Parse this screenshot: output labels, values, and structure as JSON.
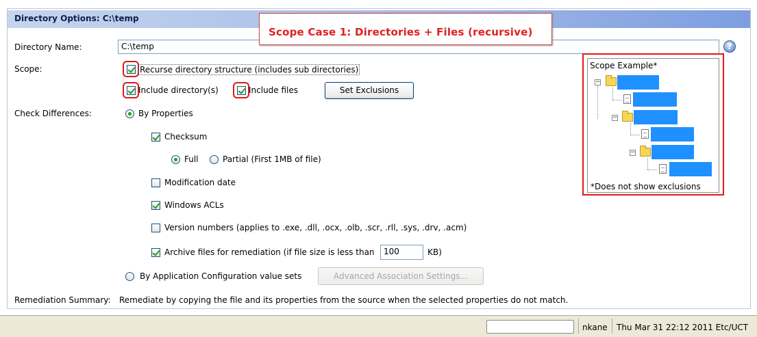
{
  "header": {
    "title": "Directory Options: C:\\temp"
  },
  "callout": {
    "text": "Scope Case 1: Directories + Files (recursive)"
  },
  "directory": {
    "label": "Directory Name:",
    "value": "C:\\temp"
  },
  "scope": {
    "label": "Scope:",
    "recurse_label": "Recurse directory structure (includes sub directories)",
    "include_dirs_label": "Include directory(s)",
    "include_files_label": "Include files",
    "set_exclusions_label": "Set Exclusions"
  },
  "check": {
    "label": "Check Differences:",
    "by_properties": "By Properties",
    "checksum": "Checksum",
    "full": "Full",
    "partial": "Partial (First 1MB of file)",
    "mod_date": "Modification date",
    "acls": "Windows ACLs",
    "version": "Version numbers (applies to .exe, .dll, .ocx, .olb, .scr, .rll, .sys, .drv, .acm)",
    "archive": "Archive files for remediation (if file size is less than",
    "archive_size": "100",
    "archive_unit": "KB)",
    "by_app_config": "By Application Configuration value sets",
    "advanced_btn": "Advanced Association Settings..."
  },
  "remediation": {
    "label": "Remediation Summary:",
    "text": "Remediate by copying the file and its properties from the source when the selected properties do not match."
  },
  "scope_example": {
    "title": "Scope Example*",
    "footnote": "*Does not show exclusions"
  },
  "status": {
    "user": "nkane",
    "datetime": "Thu Mar 31 22:12 2011 Etc/UCT"
  },
  "colors": {
    "accent": "#1e90ff",
    "callout": "#e02020",
    "check": "#21a121"
  },
  "icons": [
    "help-icon",
    "folder-icon",
    "file-icon",
    "expander-icon"
  ]
}
